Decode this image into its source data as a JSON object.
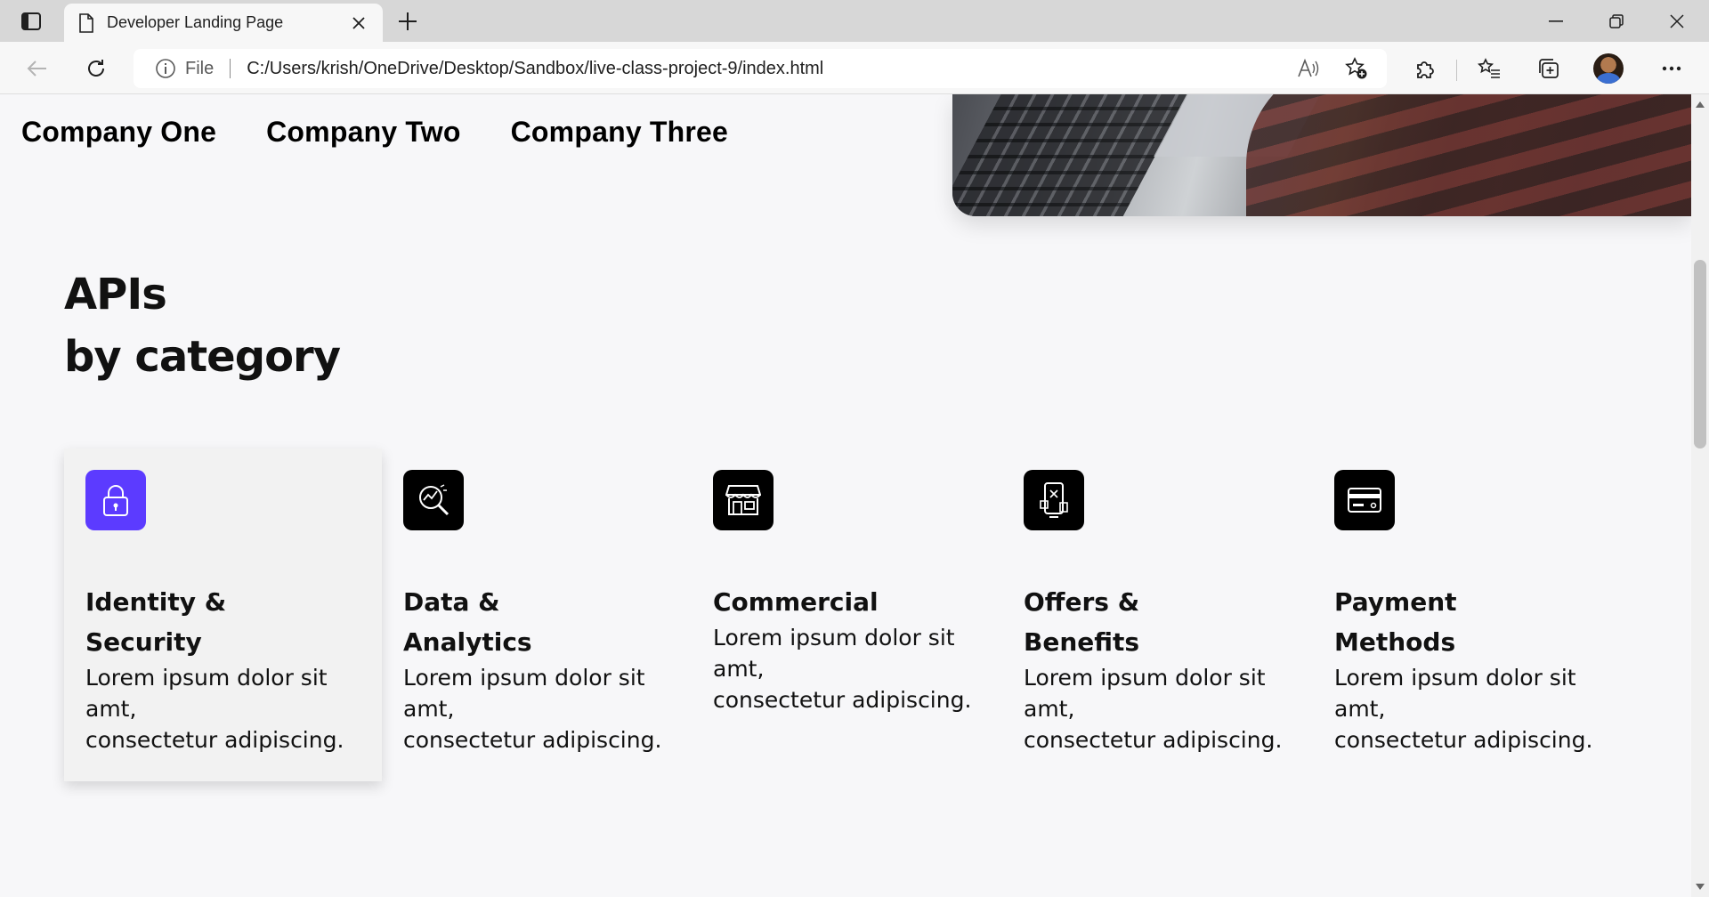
{
  "browser": {
    "tab_title": "Developer Landing Page",
    "address_label": "File",
    "url": "C:/Users/krish/OneDrive/Desktop/Sandbox/live-class-project-9/index.html"
  },
  "page": {
    "companies": [
      "Company One",
      "Company Two",
      "Company Three"
    ],
    "section_title_line1": "APIs",
    "section_title_line2": "by category",
    "accent_color": "#5c3bff",
    "categories": [
      {
        "title_line1": "Identity &",
        "title_line2": "Security",
        "desc_line1": "Lorem ipsum dolor sit",
        "desc_line2": "amt,",
        "desc_line3": "consectetur adipiscing.",
        "icon": "lock-icon",
        "active": true
      },
      {
        "title_line1": "Data &",
        "title_line2": "Analytics",
        "desc_line1": "Lorem ipsum dolor sit",
        "desc_line2": "amt,",
        "desc_line3": "consectetur adipiscing.",
        "icon": "analytics-magnifier-icon",
        "active": false
      },
      {
        "title_line1": "Commercial",
        "title_line2": "",
        "desc_line1": "Lorem ipsum dolor sit",
        "desc_line2": "amt,",
        "desc_line3": "consectetur adipiscing.",
        "icon": "storefront-icon",
        "active": false
      },
      {
        "title_line1": "Offers &",
        "title_line2": "Benefits",
        "desc_line1": "Lorem ipsum dolor sit",
        "desc_line2": "amt,",
        "desc_line3": "consectetur adipiscing.",
        "icon": "coupon-phone-icon",
        "active": false
      },
      {
        "title_line1": "Payment",
        "title_line2": "Methods",
        "desc_line1": "Lorem ipsum dolor sit",
        "desc_line2": "amt,",
        "desc_line3": "consectetur adipiscing.",
        "icon": "credit-card-icon",
        "active": false
      }
    ]
  }
}
